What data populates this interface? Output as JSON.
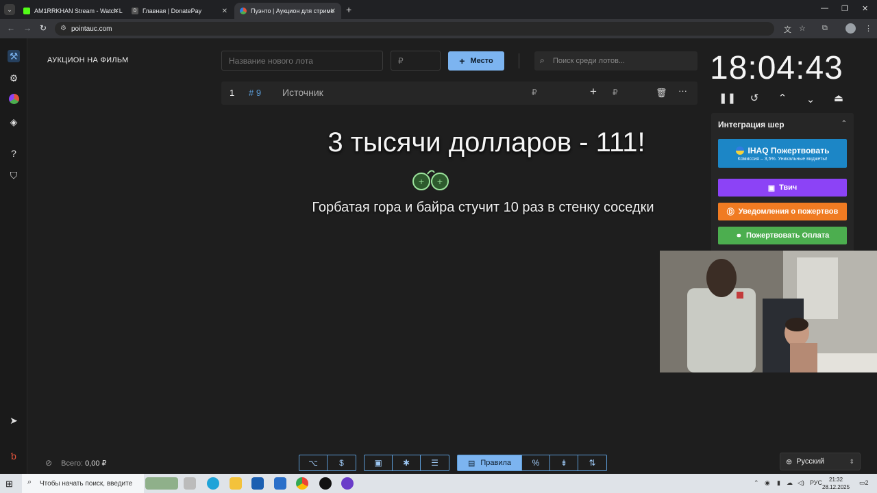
{
  "browser": {
    "tabs": [
      {
        "title": "AM1RRKHAN Stream - Watch L",
        "active": false,
        "icon": "kick-icon",
        "color": "#53fc18"
      },
      {
        "title": "Главная | DonatePay",
        "active": false,
        "icon": "donatepay-icon",
        "color": "#2b2b2b"
      },
      {
        "title": "Пуэнто | Аукцион для стриме",
        "active": true,
        "icon": "pointauc-icon",
        "color": "#e0533c"
      }
    ],
    "url": "pointauc.com"
  },
  "app": {
    "title": "АУКЦИОН НА ФИЛЬМ",
    "lot_name_placeholder": "Название нового лота",
    "lot_amount_placeholder": "₽",
    "add_button": "Место",
    "search_placeholder": "Поиск среди лотов...",
    "lot": {
      "rank": "1",
      "id": "# 9",
      "name": "Источник",
      "amount": "₽",
      "add_amount": "₽"
    },
    "overlay": {
      "headline": "3 тысячи долларов  - 111!",
      "message": "Горбатая гора и байра стучит 10 раз в стенку соседки"
    },
    "timer": "18:04:43",
    "integration": {
      "title": "Интеграция шер",
      "buttons": [
        {
          "label": "IHAQ Пожертвовать",
          "sub": "Комиссия – 3,5%. Уникальные виджеты!",
          "color": "#1c86c6"
        },
        {
          "label": "Твич",
          "color": "#8c43f6"
        },
        {
          "label": "Уведомления о пожертвов",
          "color": "#f07b22"
        },
        {
          "label": "Пожертвовать Оплата",
          "color": "#4cae4f"
        }
      ]
    },
    "total_label": "Всего:",
    "total_value": "0,00 ₽",
    "rules_button": "Правила",
    "language": "Русский"
  },
  "taskbar": {
    "search_placeholder": "Чтобы начать поиск, введите",
    "language": "РУС",
    "time": "21:32",
    "date": "28.12.2025",
    "notifications": "2"
  }
}
